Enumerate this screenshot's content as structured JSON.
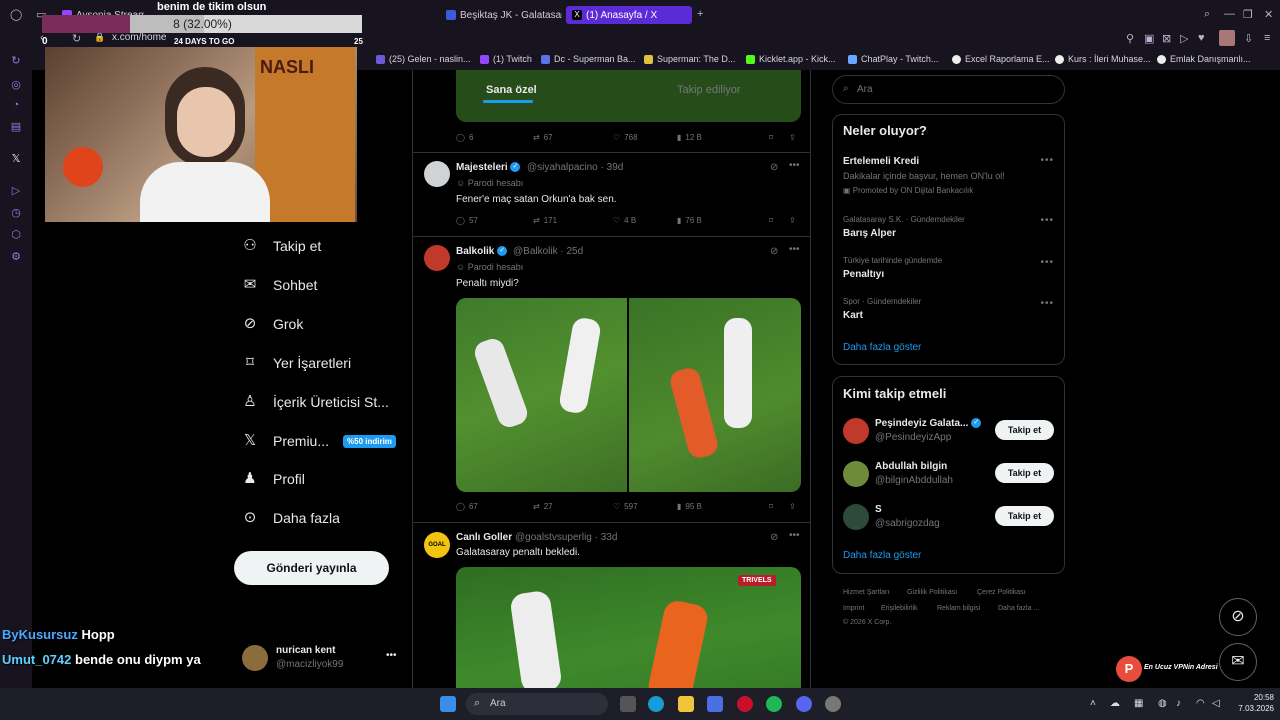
{
  "browser": {
    "tabs": [
      {
        "label": "Aysonia Stream"
      },
      {
        "label": "Beşiktaş JK - Galatasaray"
      },
      {
        "label": "(1) Anasayfa / X"
      }
    ],
    "url": "x.com/home",
    "bookmarks": [
      {
        "label": "(25) Gelen - naslin..."
      },
      {
        "label": "(1) Twitch"
      },
      {
        "label": "Dc - Superman Ba..."
      },
      {
        "label": "Superman: The D..."
      },
      {
        "label": "Kicklet.app - Kick..."
      },
      {
        "label": "ChatPlay - Twitch..."
      },
      {
        "label": "Excel Raporlama E..."
      },
      {
        "label": "Kurs : İleri Muhase..."
      },
      {
        "label": "Emlak Danışmanlı..."
      }
    ]
  },
  "overlay": {
    "title": "benim de tikim olsun",
    "goal_text": "8 (32.00%)",
    "goal_fraction": 0.32,
    "left_num": "0",
    "days_left": "24 DAYS TO GO",
    "right_num": "25"
  },
  "x_nav": {
    "items": [
      {
        "label": "Takip et"
      },
      {
        "label": "Sohbet"
      },
      {
        "label": "Grok"
      },
      {
        "label": "Yer İşaretleri"
      },
      {
        "label": "İçerik Üreticisi St..."
      },
      {
        "label": "Premiu..."
      },
      {
        "label": "Profil"
      },
      {
        "label": "Daha fazla"
      }
    ],
    "premium_badge": "%50 indirim",
    "post_button": "Gönderi yayınla",
    "account": {
      "name": "nurican kent",
      "handle": "@macizliyok99"
    }
  },
  "timeline": {
    "tabs": [
      {
        "label": "Sana özel"
      },
      {
        "label": "Takip ediliyor"
      }
    ],
    "first_actions": {
      "replies": "6",
      "reposts": "67",
      "likes": "768",
      "views": "12 B"
    },
    "tweets": [
      {
        "name": "Majesteleri",
        "handle": "@siyahalpacino",
        "time": "39d",
        "sub": "Parodi hesabı",
        "text": "Fener'e maç satan Orkun'a bak sen.",
        "replies": "57",
        "reposts": "171",
        "likes": "4 B",
        "views": "76 B"
      },
      {
        "name": "Balkolik",
        "handle": "@Balkolik",
        "time": "25d",
        "sub": "Parodi hesabı",
        "text": "Penaltı miydi?",
        "replies": "67",
        "reposts": "27",
        "likes": "597",
        "views": "95 B"
      },
      {
        "name": "Canlı Goller",
        "handle": "@goalstvsuperlig",
        "time": "33d",
        "text": "Galatasaray penaltı bekledi.",
        "media_label": "TRIVELS"
      }
    ]
  },
  "right": {
    "search_placeholder": "Ara",
    "trends_title": "Neler oluyor?",
    "promo": {
      "name": "Ertelemeli Kredi",
      "desc": "Dakikalar içinde başvur, hemen ON'lu ol!",
      "promoted": "Promoted by ON Dijital Bankacılık"
    },
    "trends": [
      {
        "meta": "Galatasaray S.K. · Gündemdekiler",
        "name": "Barış Alper"
      },
      {
        "meta": "Türkiye tarihinde gündemde",
        "name": "Penaltıyı"
      },
      {
        "meta": "Spor · Gündemdekiler",
        "name": "Kart"
      }
    ],
    "show_more": "Daha fazla göster",
    "who_title": "Kimi takip etmeli",
    "who": [
      {
        "name": "Peşindeyiz Galata...",
        "handle": "@PesindeyizApp",
        "button": "Takip et"
      },
      {
        "name": "Abdullah bilgin",
        "handle": "@bilginAbddullah",
        "button": "Takip et"
      },
      {
        "name": "S",
        "handle": "@sabrigozdag",
        "button": "Takip et"
      }
    ],
    "who_more": "Daha fazla göster",
    "footer": {
      "l1": [
        "Hizmet Şartları",
        "Gizlilik Politikası",
        "Çerez Politikası"
      ],
      "l2": [
        "Imprint",
        "Erişilebilirlik",
        "Reklam bilgisi",
        "Daha fazla ..."
      ],
      "copyright": "© 2026 X Corp."
    }
  },
  "chat": [
    {
      "user": "ByKusursuz",
      "msg": "Hopp"
    },
    {
      "user": "Umut_0742",
      "msg": "bende onu diypm ya"
    }
  ],
  "promo_badge": "En Ucuz VPNin Adresi",
  "taskbar": {
    "search": "Ara",
    "time": "20:58",
    "date": "7.03.2026"
  }
}
